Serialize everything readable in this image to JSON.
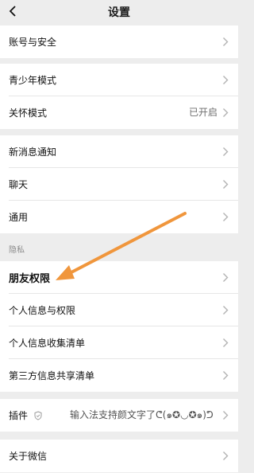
{
  "header": {
    "title": "设置"
  },
  "groups": {
    "account": {
      "label": "账号与安全"
    },
    "teen": {
      "label": "青少年模式"
    },
    "care": {
      "label": "关怀模式",
      "value": "已开启"
    },
    "notify": {
      "label": "新消息通知"
    },
    "chat": {
      "label": "聊天"
    },
    "general": {
      "label": "通用"
    },
    "privacy_section": {
      "label": "隐私"
    },
    "friend_perm": {
      "label": "朋友权限"
    },
    "personal_info": {
      "label": "个人信息与权限"
    },
    "collect_list": {
      "label": "个人信息收集清单"
    },
    "third_party": {
      "label": "第三方信息共享清单"
    },
    "plugins": {
      "label": "插件",
      "value": "输入法支持颜文字了ᕦ(๑✪◡✪๑)ᕤ"
    },
    "about": {
      "label": "关于微信"
    }
  },
  "colors": {
    "background": "#ededed",
    "row": "#ffffff",
    "arrow": "#f0963c"
  }
}
